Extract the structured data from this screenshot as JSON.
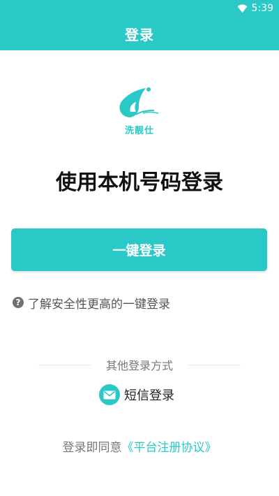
{
  "colors": {
    "accent": "#2bc8c8",
    "text_dark": "#111111",
    "text_muted": "#777777"
  },
  "status_bar": {
    "time": "5:39",
    "wifi_icon": "wifi-icon"
  },
  "header": {
    "title": "登录"
  },
  "logo": {
    "text": "洗靓仕",
    "icon": "water-drop-logo-icon"
  },
  "main": {
    "title": "使用本机号码登录",
    "login_button_label": "一键登录",
    "help_icon": "question-circle-icon",
    "help_text": "了解安全性更高的一键登录"
  },
  "other_methods": {
    "title": "其他登录方式",
    "sms_icon": "mail-icon",
    "sms_label": "短信登录"
  },
  "agreement": {
    "prefix": "登录即同意",
    "link_text": "《平台注册协议》"
  }
}
